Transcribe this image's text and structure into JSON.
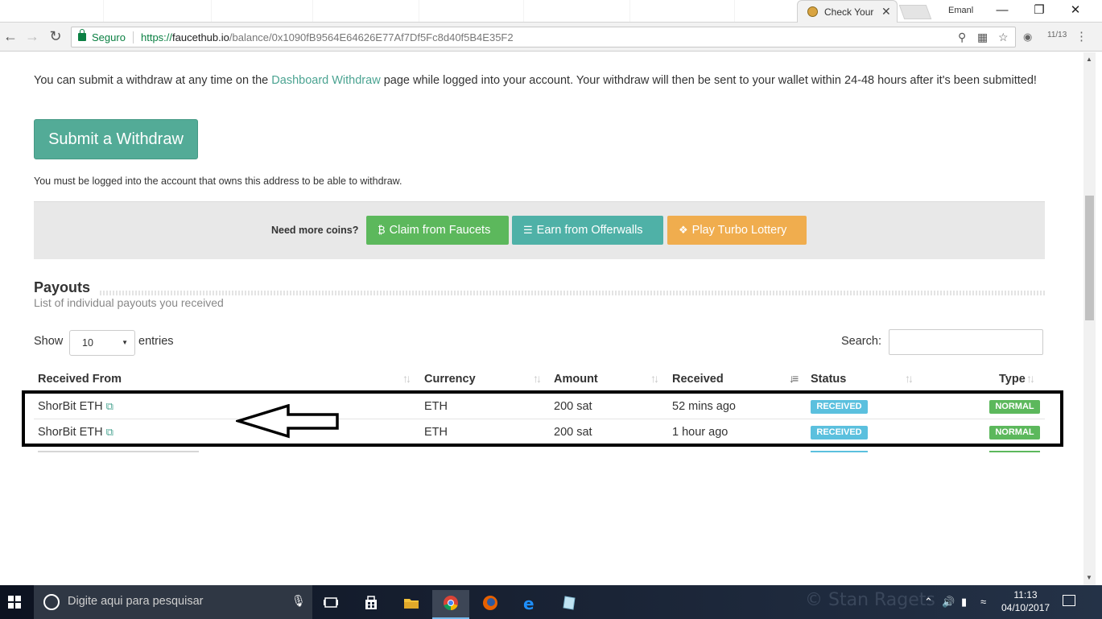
{
  "browser": {
    "tab_title": "Check Your",
    "tab_close": "✕",
    "profile_name": "Emanl",
    "secure_label": "Seguro",
    "url_scheme": "https://",
    "url_host": "faucethub.io",
    "url_path": "/balance/0x1090fB9564E64626E77Af7Df5Fc8d40f5B4E35F2"
  },
  "page": {
    "intro_before": "You can submit a withdraw at any time on the ",
    "intro_link": "Dashboard Withdraw",
    "intro_after": " page while logged into your account. Your withdraw will then be sent to your wallet within 24-48 hours after it's been submitted!",
    "submit_button": "Submit a Withdraw",
    "login_note": "You must be logged into the account that owns this address to be able to withdraw.",
    "need_more": "Need more coins?",
    "buttons": [
      {
        "label": "Claim from Faucets",
        "icon": "bitcoin-icon",
        "color": "#5cb85c"
      },
      {
        "label": "Earn from Offerwalls",
        "icon": "list-icon",
        "color": "#4fb1a7"
      },
      {
        "label": "Play Turbo Lottery",
        "icon": "ticket-icon",
        "color": "#f0ad4e"
      }
    ],
    "payouts_title": "Payouts",
    "payouts_subtitle": "List of individual payouts you received",
    "show_label": "Show",
    "entries_value": "10",
    "entries_label": "entries",
    "search_label": "Search:",
    "search_value": ""
  },
  "table": {
    "headers": [
      "Received From",
      "Currency",
      "Amount",
      "Received",
      "Status",
      "Type"
    ],
    "rows": [
      {
        "from": "ShorBit ETH",
        "currency": "ETH",
        "amount": "200 sat",
        "received": "52 mins ago",
        "status": "RECEIVED",
        "type": "NORMAL"
      },
      {
        "from": "ShorBit ETH",
        "currency": "ETH",
        "amount": "200 sat",
        "received": "1 hour ago",
        "status": "RECEIVED",
        "type": "NORMAL"
      }
    ]
  },
  "taskbar": {
    "search_placeholder": "Digite aqui para pesquisar",
    "watermark": "© Stan Ragets",
    "time": "11:13",
    "date": "04/10/2017"
  },
  "colors": {
    "accent": "#53ab97",
    "link": "#4aa391",
    "received_badge": "#5bc0de",
    "normal_badge": "#5cb85c"
  }
}
